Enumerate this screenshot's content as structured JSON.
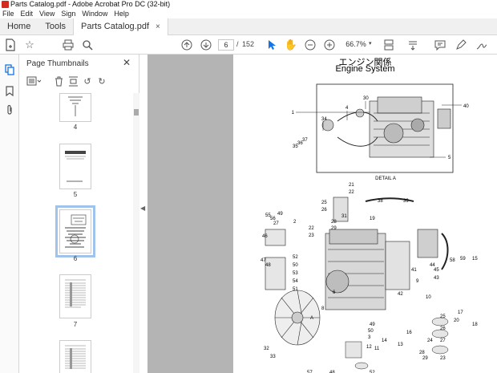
{
  "window": {
    "title": "Parts Catalog.pdf - Adobe Acrobat Pro DC (32-bit)"
  },
  "menu": [
    "File",
    "Edit",
    "View",
    "Sign",
    "Window",
    "Help"
  ],
  "tabs": {
    "home": "Home",
    "tools": "Tools",
    "document": "Parts Catalog.pdf",
    "close": "×"
  },
  "toolbar": {
    "page_current": "6",
    "page_sep": "/",
    "page_total": "152",
    "zoom": "66.7%"
  },
  "panel": {
    "title": "Page Thumbnails",
    "thumbnails": [
      {
        "label": "4"
      },
      {
        "label": "5"
      },
      {
        "label": "6",
        "selected": true
      },
      {
        "label": "7"
      }
    ]
  },
  "document_page": {
    "title_jp": "エンジン関係",
    "title_en": "Engine System",
    "detail_label": "DETAIL A",
    "callouts": [
      "1",
      "4",
      "30",
      "40",
      "34",
      "36",
      "37",
      "35",
      "5",
      "21",
      "22",
      "25",
      "38",
      "39",
      "26",
      "49",
      "56",
      "55",
      "27",
      "2",
      "28",
      "31",
      "19",
      "23",
      "29",
      "46",
      "52",
      "50",
      "53",
      "54",
      "47",
      "9",
      "41",
      "42",
      "44",
      "43",
      "45",
      "58",
      "59",
      "15",
      "10",
      "17",
      "20",
      "18",
      "16",
      "13",
      "14",
      "11",
      "12",
      "6",
      "57",
      "8",
      "3",
      "24",
      "32",
      "33",
      "48"
    ]
  },
  "colors": {
    "accent": "#1473e6",
    "canvas": "#b4b4b4",
    "selected_outline": "#9fc3ea"
  }
}
